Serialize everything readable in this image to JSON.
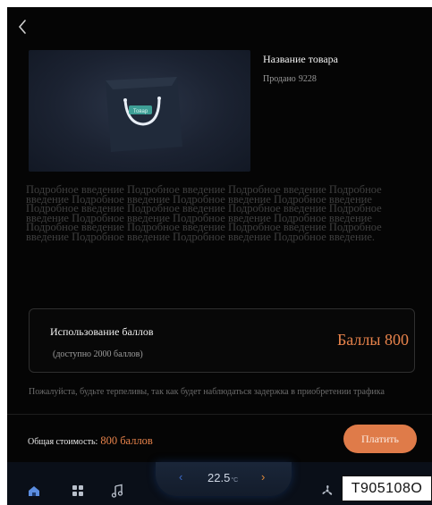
{
  "header": {
    "back_icon": "chevron-left-icon"
  },
  "product": {
    "image_icon": "shopping-bag-icon",
    "bag_tag": "Товар",
    "name": "Название товара",
    "sold_label": "Продано",
    "sold_count": "9228"
  },
  "description": "Подробное введение Подробное введение Подробное введение Подробное введение Подробное введение Подробное введение Подробное введение Подробное введение Подробное введение Подробное введение Подробное введение Подробное введение Подробное введение Подробное введение Подробное введение Подробное введение Подробное введение Подробное введение Подробное введение Подробное введение Подробное введение.",
  "points": {
    "title": "Использование баллов",
    "available": "(доступно 2000 баллов)",
    "value": "Баллы 800"
  },
  "notice": "Пожалуйста, будьте терпеливы, так как будет наблюдаться задержка в приобретении трафика",
  "footer": {
    "total_label": "Общая стоимость:",
    "total_value": "800 баллов",
    "pay_label": "Платить"
  },
  "dock": {
    "items": [
      "home-icon",
      "apps-grid-icon",
      "music-note-icon",
      "fan-icon"
    ],
    "temperature": "22.5",
    "temperature_unit": "°C"
  },
  "watermark": "T905108O",
  "colors": {
    "background": "#050505",
    "accent": "#df7b49",
    "accent_text": "#e8834b",
    "dock_active": "#5b8de0"
  }
}
